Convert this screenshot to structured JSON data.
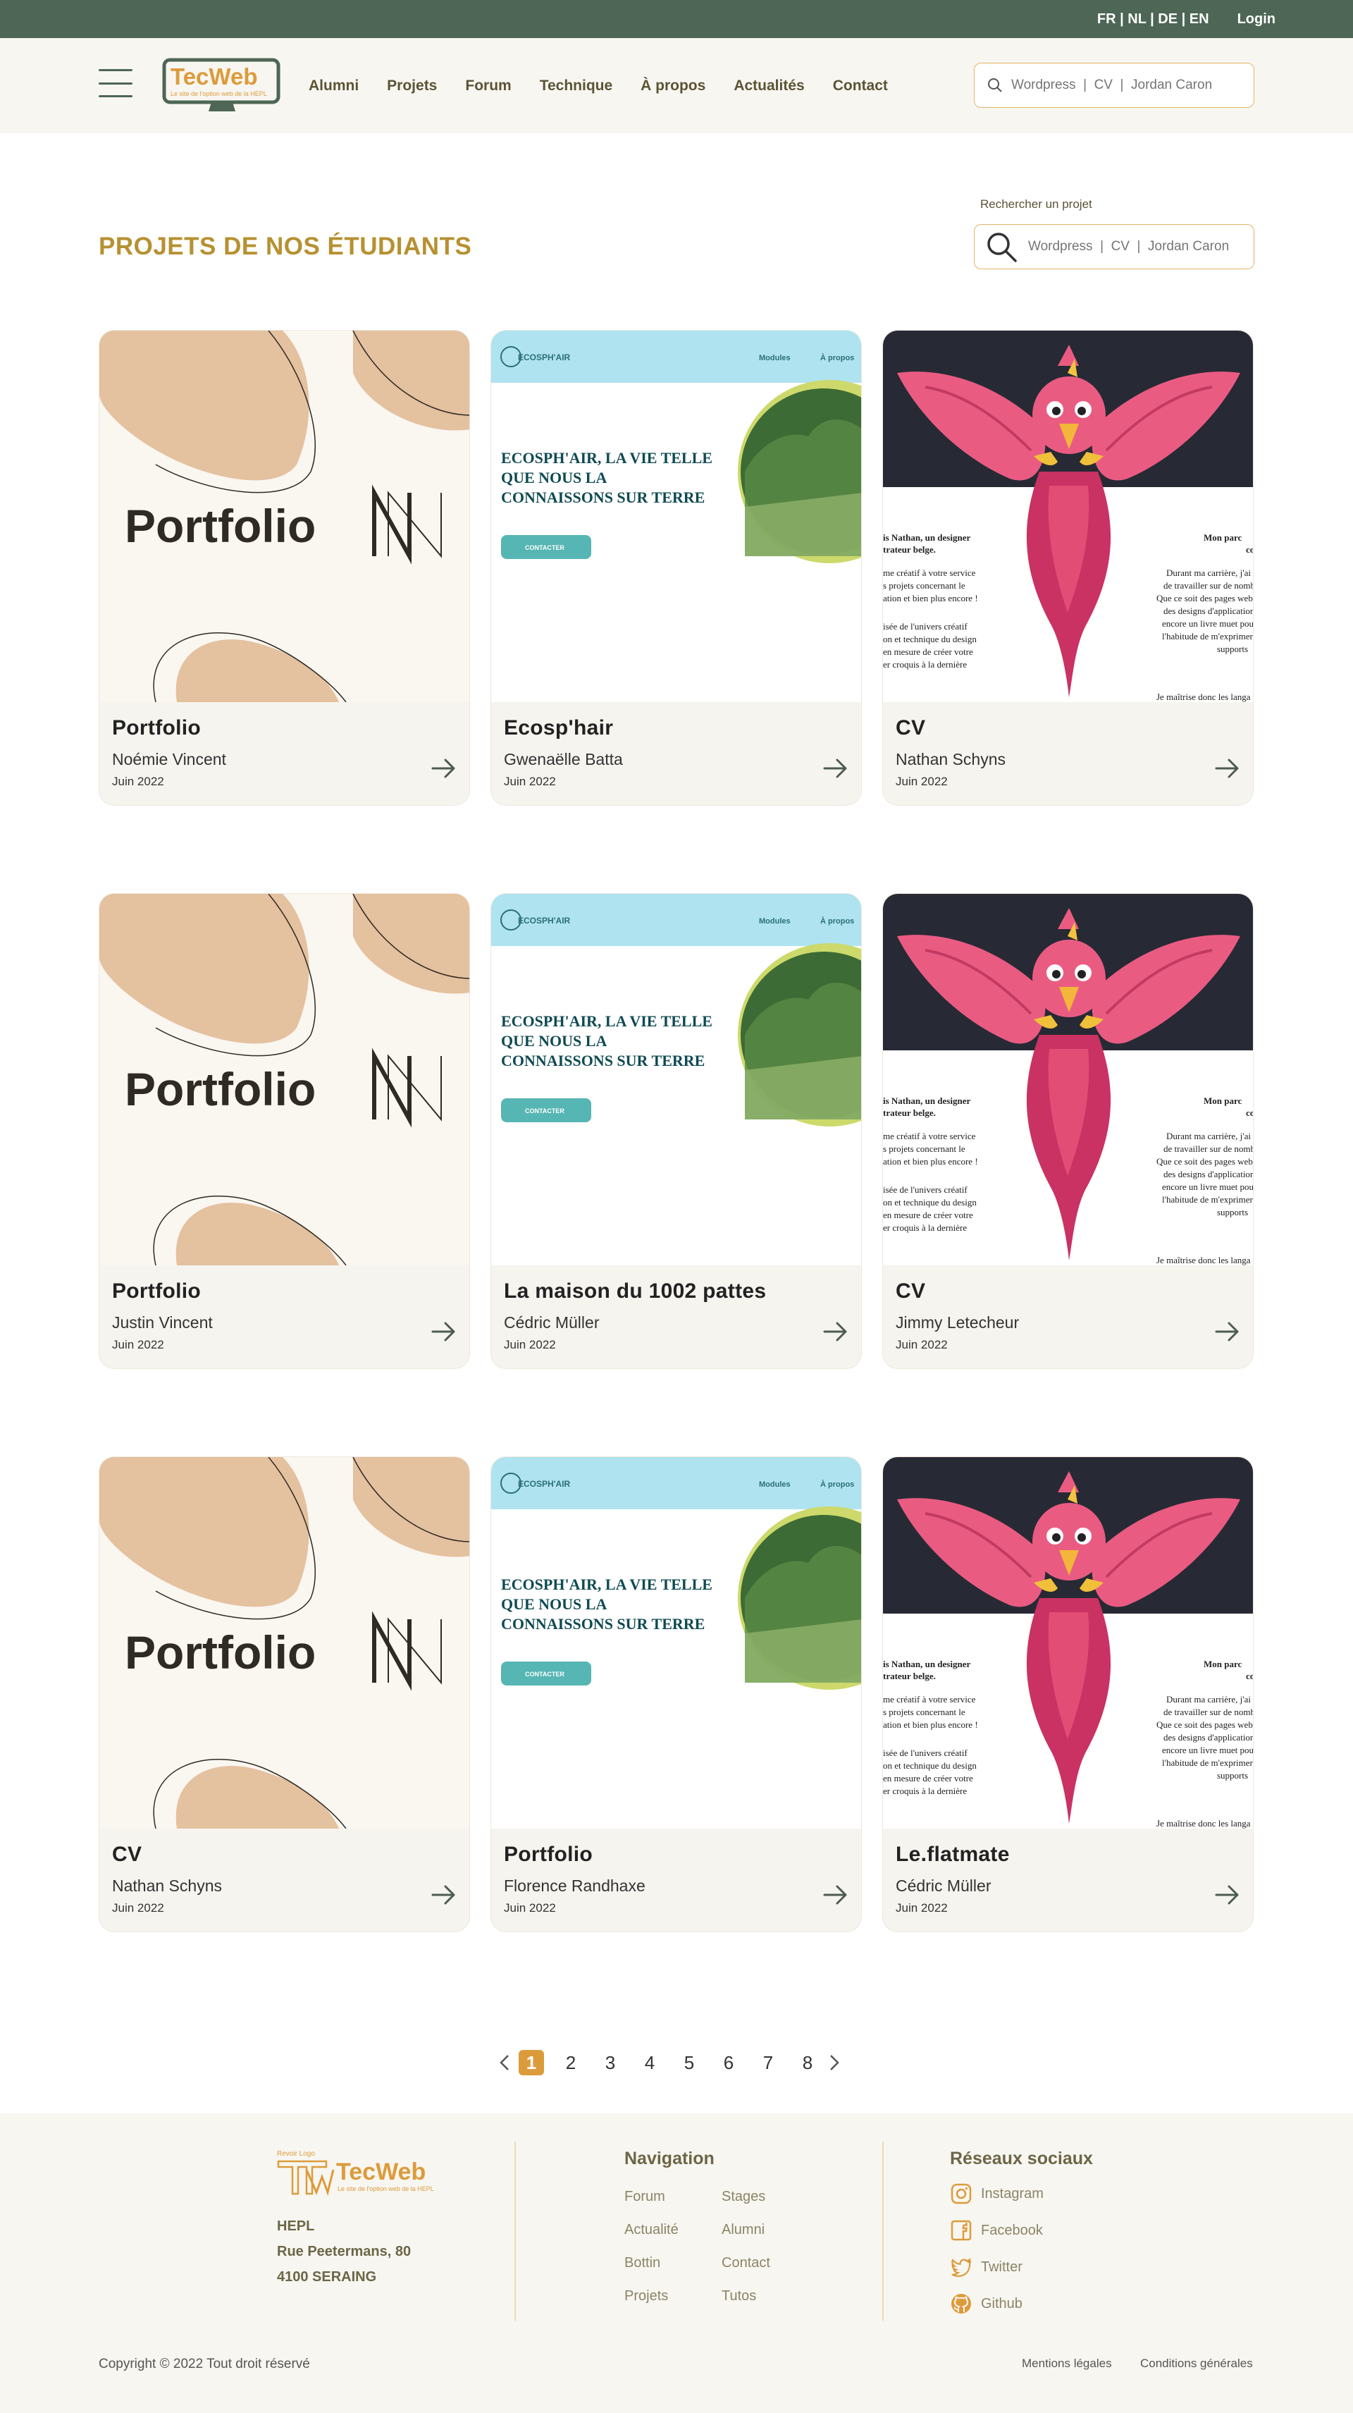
{
  "topbar": {
    "languages": "FR | NL | DE | EN",
    "login": "Login"
  },
  "logo": {
    "name": "TecWeb",
    "tagline": "Le site de l'option web de la HEPL"
  },
  "nav": [
    "Alumni",
    "Projets",
    "Forum",
    "Technique",
    "À propos",
    "Actualités",
    "Contact"
  ],
  "header_search": {
    "placeholder": "Wordpress  |  CV  |  Jordan Caron"
  },
  "page": {
    "title": "PROJETS DE NOS ÉTUDIANTS",
    "search_label": "Rechercher un projet",
    "search_placeholder": "Wordpress  |  CV  |  Jordan Caron"
  },
  "thumbs": {
    "portfolio_word": "Portfolio",
    "eco_brand": "ECOSPH'AIR",
    "eco_nav1": "Modules",
    "eco_nav2": "À propos",
    "eco_headline1": "ECOSPH'AIR, LA VIE TELLE",
    "eco_headline2": "QUE NOUS LA",
    "eco_headline3": "CONNAISSONS SUR TERRE",
    "eco_cta": "CONTACTER",
    "cv_left1": "is Nathan, un designer",
    "cv_left2": "trateur belge.",
    "cv_left3": "me créatif à votre service",
    "cv_left4": "s projets concernant le",
    "cv_left5": "ation et bien plus encore !",
    "cv_left6": "isée de l'univers créatif",
    "cv_left7": "on et technique du design",
    "cv_left8": "en mesure de créer votre",
    "cv_left9": "er croquis à la dernière",
    "cv_right1": "Mon parc",
    "cv_right2": "co",
    "cv_right3": "Durant ma carrière, j'ai",
    "cv_right4": "de travailler sur de nomb",
    "cv_right5": "Que ce soit des pages web",
    "cv_right6": "des designs d'application",
    "cv_right7": "encore un livre muet pour",
    "cv_right8": "l'habitude de m'exprimer",
    "cv_right9": "supports",
    "cv_right10": "Je maîtrise donc les langa"
  },
  "cards": [
    {
      "thumb": "portfolio",
      "title": "Portfolio",
      "author": "Noémie Vincent",
      "date": "Juin 2022"
    },
    {
      "thumb": "eco",
      "title": "Ecosp'hair",
      "author": "Gwenaëlle Batta",
      "date": "Juin 2022"
    },
    {
      "thumb": "cv",
      "title": "CV",
      "author": "Nathan Schyns",
      "date": "Juin 2022"
    },
    {
      "thumb": "portfolio",
      "title": "Portfolio",
      "author": "Justin Vincent",
      "date": "Juin 2022"
    },
    {
      "thumb": "eco",
      "title": "La maison du 1002 pattes",
      "author": "Cédric Müller",
      "date": "Juin 2022"
    },
    {
      "thumb": "cv",
      "title": "CV",
      "author": "Jimmy Letecheur",
      "date": "Juin 2022"
    },
    {
      "thumb": "portfolio",
      "title": "CV",
      "author": "Nathan Schyns",
      "date": "Juin 2022"
    },
    {
      "thumb": "eco",
      "title": "Portfolio",
      "author": "Florence Randhaxe",
      "date": "Juin 2022"
    },
    {
      "thumb": "cv",
      "title": "Le.flatmate",
      "author": "Cédric Müller",
      "date": "Juin 2022"
    }
  ],
  "pagination": {
    "current": "1",
    "pages": [
      "2",
      "3",
      "4",
      "5",
      "6",
      "7",
      "8"
    ]
  },
  "footer": {
    "logo_note": "Revoir Logo",
    "logo_name": "TecWeb",
    "logo_tagline": "Le site de l'option web de la HEPL",
    "address_line1": "HEPL",
    "address_line2": "Rue Peetermans, 80",
    "address_line3": "4100 SERAING",
    "nav_heading": "Navigation",
    "nav_links": [
      "Forum",
      "Stages",
      "Actualité",
      "Alumni",
      "Bottin",
      "Contact",
      "Projets",
      "Tutos"
    ],
    "social_heading": "Réseaux sociaux",
    "social": [
      "Instagram",
      "Facebook",
      "Twitter",
      "Github"
    ],
    "copyright": "Copyright © 2022 Tout droit réservé",
    "legal": "Mentions légales",
    "terms": "Conditions générales"
  },
  "colors": {
    "topbar": "#4d6655",
    "accent_gold": "#b69131",
    "search_border": "#e6b466",
    "page_current": "#dc9b3b",
    "footer_bg": "#f8f6f1"
  }
}
